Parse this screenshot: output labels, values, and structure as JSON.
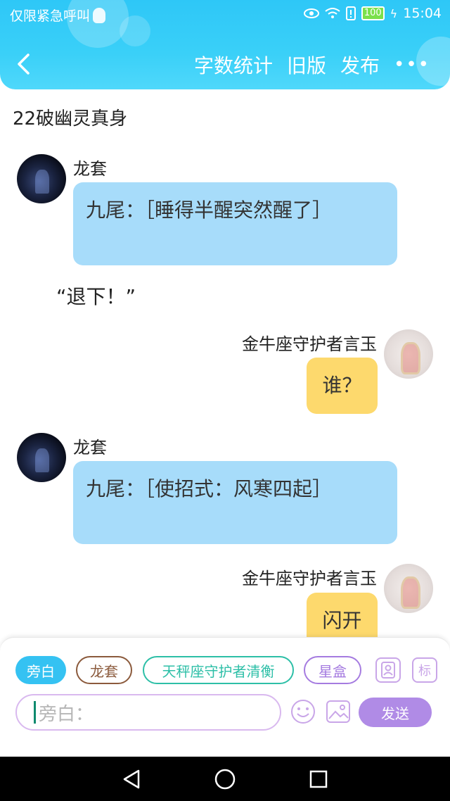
{
  "status_bar": {
    "carrier": "仅限紧急呼叫",
    "battery": "100",
    "time": "15:04"
  },
  "header": {
    "actions": [
      "字数统计",
      "旧版",
      "发布"
    ],
    "more": "•••"
  },
  "story": {
    "title": "22破幽灵真身"
  },
  "messages": {
    "m1": {
      "name": "龙套",
      "text": "九尾：［睡得半醒突然醒了］"
    },
    "narration": "“退下！”",
    "m2": {
      "name": "金牛座守护者言玉",
      "text": "谁？"
    },
    "m3": {
      "name": "龙套",
      "text": "九尾：［使招式：风寒四起］"
    },
    "m4": {
      "name": "金牛座守护者言玉",
      "text": "闪开"
    }
  },
  "composer": {
    "chips": [
      "旁白",
      "龙套",
      "天秤座守护者清衡",
      "星盒"
    ],
    "tag_button": "标",
    "input_placeholder": "旁白：",
    "send_label": "发送"
  }
}
